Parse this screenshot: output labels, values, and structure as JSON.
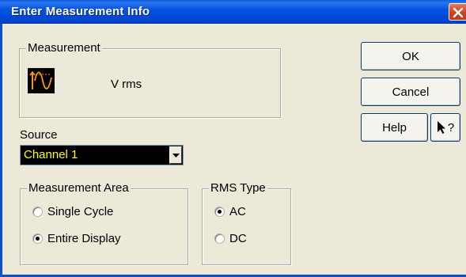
{
  "window": {
    "title": "Enter Measurement Info",
    "close_label": "Close"
  },
  "measurement": {
    "group_label": "Measurement",
    "icon": "waveform-rms-icon",
    "name": "V rms"
  },
  "buttons": {
    "ok": "OK",
    "cancel": "Cancel",
    "help": "Help",
    "whats_this": "?"
  },
  "source": {
    "label": "Source",
    "selected": "Channel 1"
  },
  "measurement_area": {
    "group_label": "Measurement Area",
    "options": [
      {
        "label": "Single Cycle",
        "checked": false
      },
      {
        "label": "Entire Display",
        "checked": true
      }
    ]
  },
  "rms_type": {
    "group_label": "RMS Type",
    "options": [
      {
        "label": "AC",
        "checked": true
      },
      {
        "label": "DC",
        "checked": false
      }
    ]
  },
  "colors": {
    "titlebar": "#0054e3",
    "dialog_bg": "#ece9d8",
    "select_bg": "#000000",
    "select_text": "#ffff00",
    "icon_wave": "#ff9900"
  }
}
